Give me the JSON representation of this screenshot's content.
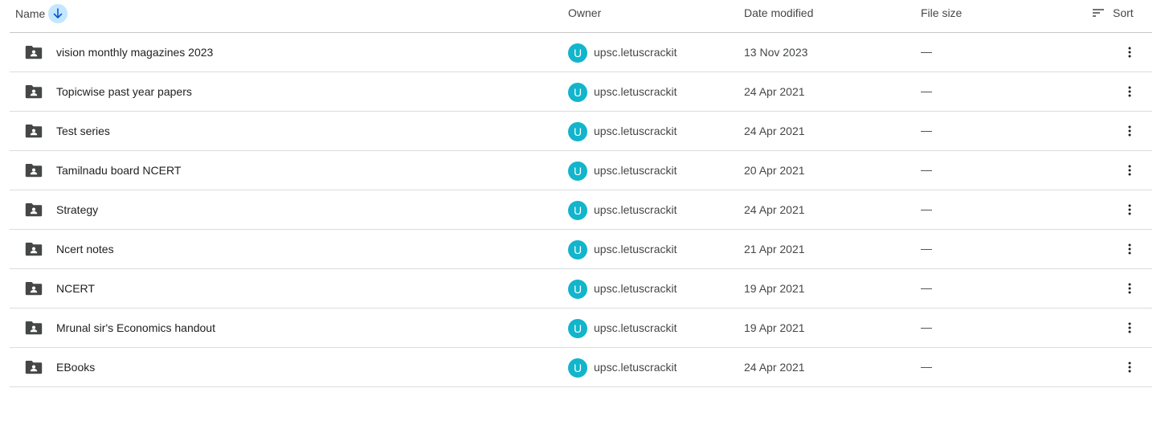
{
  "header": {
    "name_label": "Name",
    "owner_label": "Owner",
    "date_label": "Date modified",
    "size_label": "File size",
    "sort_label": "Sort",
    "sort_direction_icon": "arrow-down-icon",
    "accent_color": "#c2e7ff"
  },
  "rows": [
    {
      "name": "vision monthly magazines 2023",
      "avatar": "U",
      "owner": "upsc.letuscrackit",
      "date": "13 Nov 2023",
      "size": "—"
    },
    {
      "name": "Topicwise past year papers",
      "avatar": "U",
      "owner": "upsc.letuscrackit",
      "date": "24 Apr 2021",
      "size": "—"
    },
    {
      "name": "Test series",
      "avatar": "U",
      "owner": "upsc.letuscrackit",
      "date": "24 Apr 2021",
      "size": "—"
    },
    {
      "name": "Tamilnadu board NCERT",
      "avatar": "U",
      "owner": "upsc.letuscrackit",
      "date": "20 Apr 2021",
      "size": "—"
    },
    {
      "name": "Strategy",
      "avatar": "U",
      "owner": "upsc.letuscrackit",
      "date": "24 Apr 2021",
      "size": "—"
    },
    {
      "name": "Ncert notes",
      "avatar": "U",
      "owner": "upsc.letuscrackit",
      "date": "21 Apr 2021",
      "size": "—"
    },
    {
      "name": "NCERT",
      "avatar": "U",
      "owner": "upsc.letuscrackit",
      "date": "19 Apr 2021",
      "size": "—"
    },
    {
      "name": "Mrunal sir's Economics handout",
      "avatar": "U",
      "owner": "upsc.letuscrackit",
      "date": "19 Apr 2021",
      "size": "—"
    },
    {
      "name": "EBooks",
      "avatar": "U",
      "owner": "upsc.letuscrackit",
      "date": "24 Apr 2021",
      "size": "—"
    }
  ],
  "icons": {
    "folder": "shared-folder-icon",
    "more": "more-vert-icon",
    "sort": "sort-lines-icon"
  },
  "colors": {
    "avatar_bg": "#12b5cb",
    "folder": "#444746"
  }
}
